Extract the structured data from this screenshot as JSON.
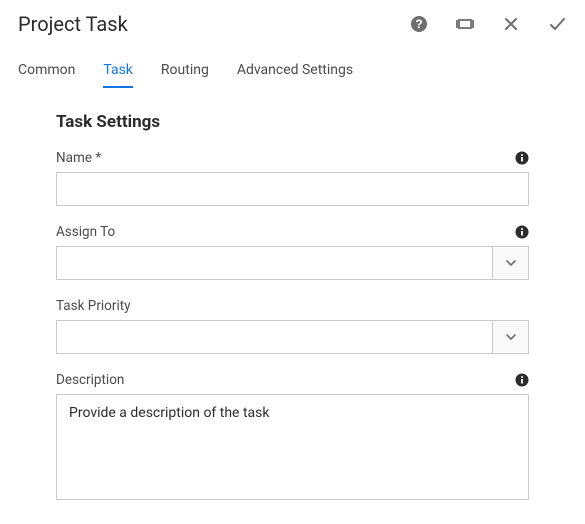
{
  "header": {
    "title": "Project Task"
  },
  "tabs": {
    "common": "Common",
    "task": "Task",
    "routing": "Routing",
    "advanced": "Advanced Settings",
    "active": "task"
  },
  "section": {
    "title": "Task Settings"
  },
  "fields": {
    "name": {
      "label": "Name *",
      "value": ""
    },
    "assignTo": {
      "label": "Assign To",
      "value": ""
    },
    "priority": {
      "label": "Task Priority",
      "value": ""
    },
    "description": {
      "label": "Description",
      "placeholder": "Provide a description of the task",
      "value": ""
    }
  }
}
